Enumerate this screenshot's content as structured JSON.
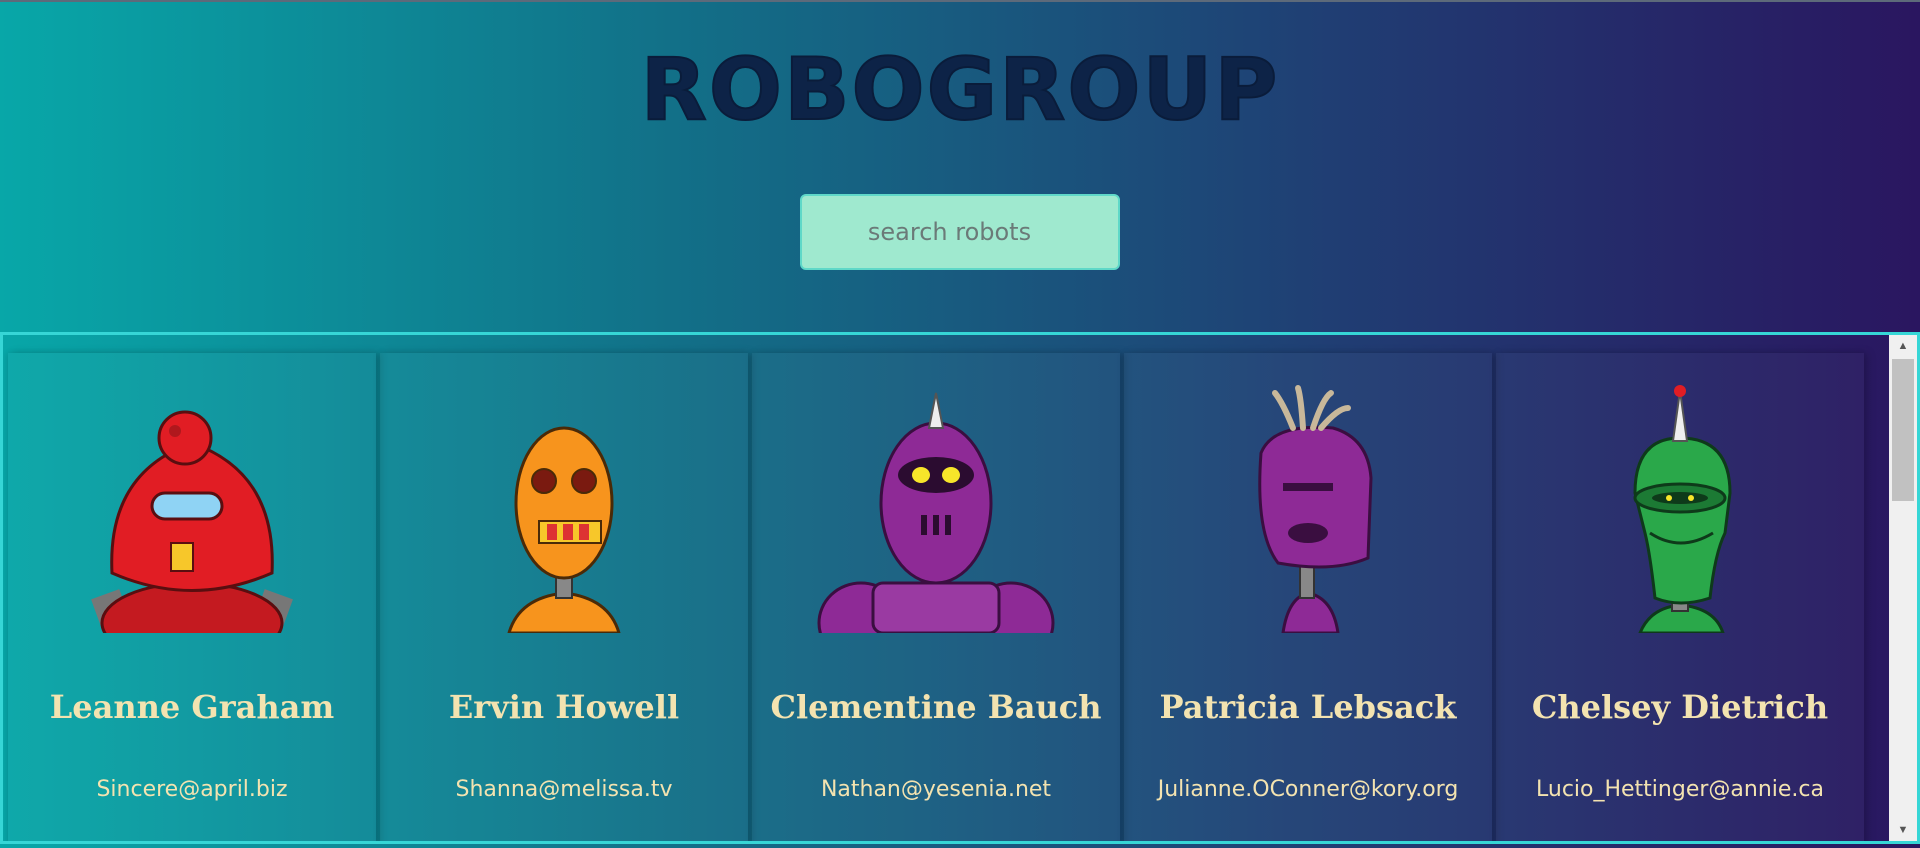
{
  "header": {
    "logo": "ROBOGROUP"
  },
  "search": {
    "placeholder": "search robots"
  },
  "colors": {
    "accent": "#36d6d6",
    "name_text": "#f3e3b0",
    "search_bg": "#9fe9cf"
  },
  "robots": [
    {
      "name": "Leanne Graham",
      "email": "Sincere@april.biz",
      "avatar_icon": "red-robot-icon",
      "color": "#e11d24"
    },
    {
      "name": "Ervin Howell",
      "email": "Shanna@melissa.tv",
      "avatar_icon": "orange-robot-icon",
      "color": "#f7941d"
    },
    {
      "name": "Clementine Bauch",
      "email": "Nathan@yesenia.net",
      "avatar_icon": "purple-robot-icon",
      "color": "#8e2a96"
    },
    {
      "name": "Patricia Lebsack",
      "email": "Julianne.OConner@kory.org",
      "avatar_icon": "purple-box-robot-icon",
      "color": "#8e2a96"
    },
    {
      "name": "Chelsey Dietrich",
      "email": "Lucio_Hettinger@annie.ca",
      "avatar_icon": "green-robot-icon",
      "color": "#2aa84a"
    }
  ],
  "scrollbar": {
    "up_arrow": "▲",
    "down_arrow": "▼"
  }
}
